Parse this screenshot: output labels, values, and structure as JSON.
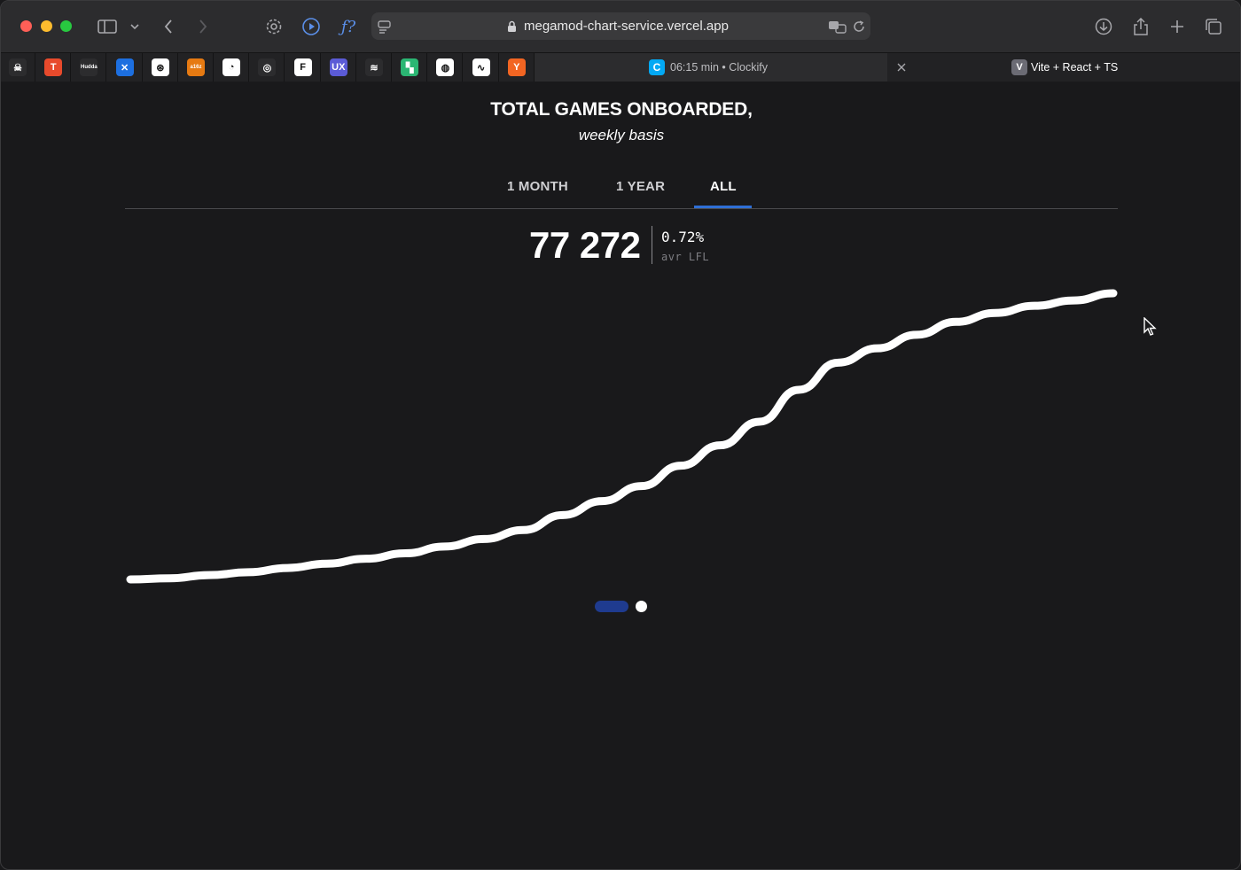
{
  "browser": {
    "url": "megamod-chart-service.vercel.app",
    "tabs": [
      {
        "label": "06:15 min • Clockify",
        "active": true
      },
      {
        "label": "Vite + React + TS",
        "active": false
      }
    ],
    "favicons": [
      {
        "name": "skull-icon",
        "color": "#2c2c2e",
        "glyph": "☠"
      },
      {
        "name": "toptal-icon",
        "color": "#e84a2c",
        "glyph": "T"
      },
      {
        "name": "hudda-icon",
        "color": "#2c2c2e",
        "glyph": "Hudda"
      },
      {
        "name": "butterfly-icon",
        "color": "#1d6fe0",
        "glyph": "✕"
      },
      {
        "name": "openai-icon",
        "color": "#ffffff",
        "glyph": "⊛"
      },
      {
        "name": "a16z-icon",
        "color": "#e67a12",
        "glyph": "a16z"
      },
      {
        "name": "speedtest-icon",
        "color": "#ffffff",
        "glyph": "◔"
      },
      {
        "name": "rings-icon",
        "color": "#2c2c2e",
        "glyph": "◎"
      },
      {
        "name": "framer-icon",
        "color": "#ffffff",
        "glyph": "F"
      },
      {
        "name": "ux-icon",
        "color": "#5b5bd6",
        "glyph": "UX"
      },
      {
        "name": "stack-icon",
        "color": "#2c2c2e",
        "glyph": "≋"
      },
      {
        "name": "grid-icon",
        "color": "#2bb673",
        "glyph": "▚"
      },
      {
        "name": "globe-icon",
        "color": "#ffffff",
        "glyph": "◍"
      },
      {
        "name": "pulse-icon",
        "color": "#ffffff",
        "glyph": "∿"
      },
      {
        "name": "ycombinator-icon",
        "color": "#f26522",
        "glyph": "Y"
      }
    ]
  },
  "page": {
    "title": "TOTAL GAMES ONBOARDED,",
    "subtitle": "weekly basis",
    "ranges": [
      "1 MONTH",
      "1 YEAR",
      "ALL"
    ],
    "selected_range": "ALL",
    "total": "77 272",
    "change": "0.72%",
    "change_label": "avr LFL",
    "accent": "#2f6fd6",
    "pagination_active_color": "#1f3b8f"
  },
  "chart_data": {
    "type": "line",
    "title": "TOTAL GAMES ONBOARDED,",
    "subtitle": "weekly basis",
    "xlabel": "",
    "ylabel": "",
    "grid": false,
    "series": [
      {
        "values": [
          0,
          0.3,
          1.2,
          2.0,
          3.2,
          4.4,
          5.8,
          7.3,
          9.2,
          11.3,
          13.8,
          18.0,
          21.9,
          26.1,
          31.8,
          37.5,
          44.1,
          53.0,
          60.6,
          64.6,
          68.4,
          72.0,
          74.5,
          76.5,
          78.0,
          80.0
        ]
      }
    ]
  }
}
